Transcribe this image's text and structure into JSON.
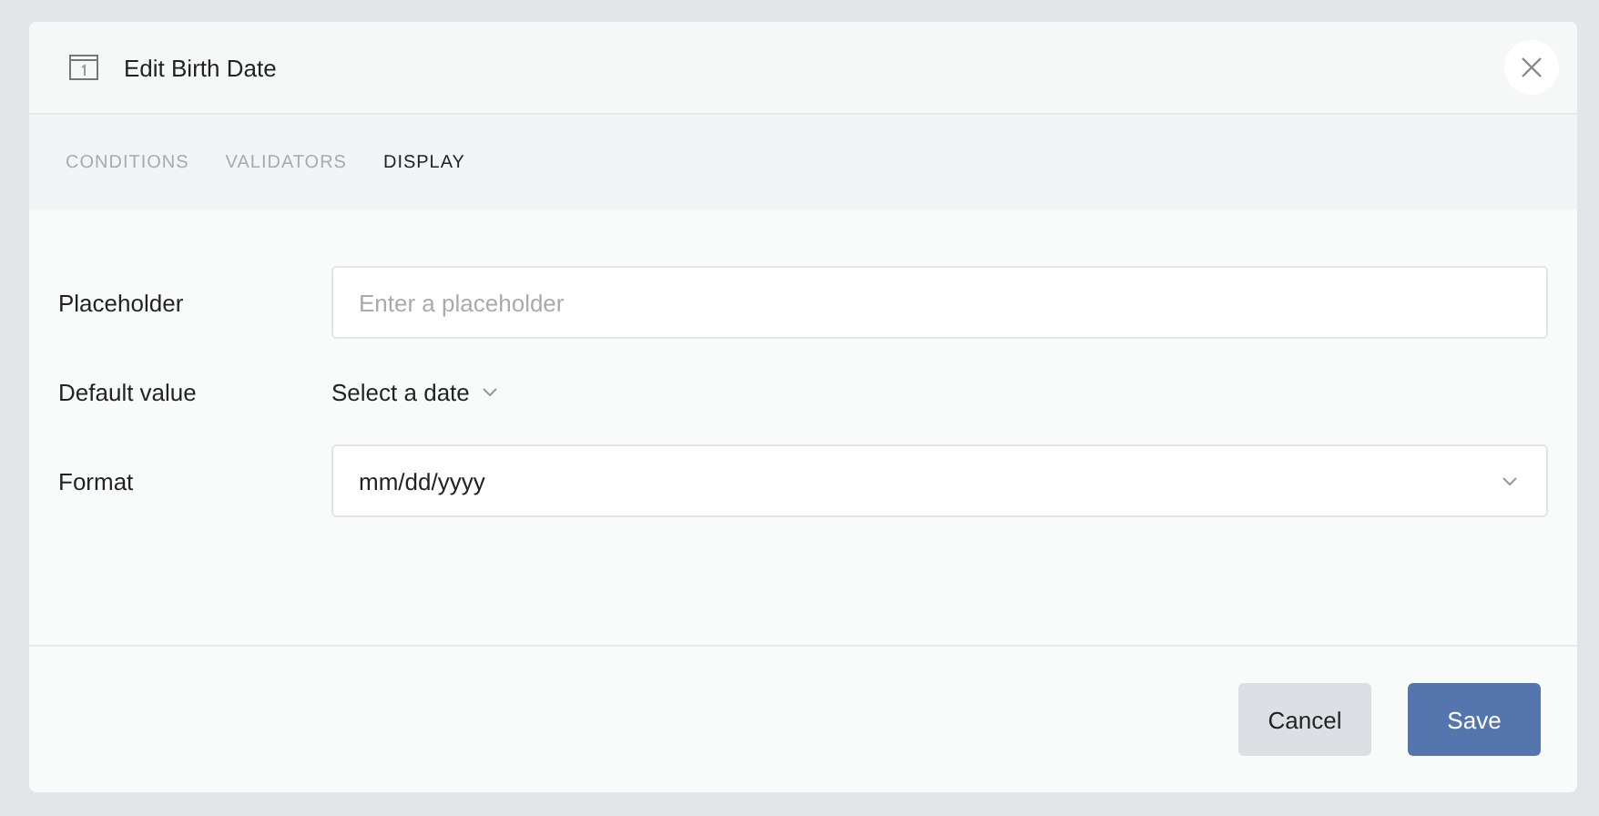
{
  "dialog": {
    "title": "Edit Birth Date"
  },
  "tabs": [
    {
      "label": "CONDITIONS",
      "selected": false
    },
    {
      "label": "VALIDATORS",
      "selected": false
    },
    {
      "label": "DISPLAY",
      "selected": true
    }
  ],
  "fields": [
    {
      "label": "Placeholder",
      "kind": "input",
      "placeholder": "Enter a placeholder"
    },
    {
      "label": "Default value",
      "kind": "datepicker",
      "value": "Select a date"
    },
    {
      "label": "Format",
      "kind": "select",
      "value": "mm/dd/yyyy"
    }
  ],
  "buttons": [
    {
      "label": "Cancel",
      "kind": "secondary"
    },
    {
      "label": "Save",
      "kind": "primary"
    }
  ]
}
